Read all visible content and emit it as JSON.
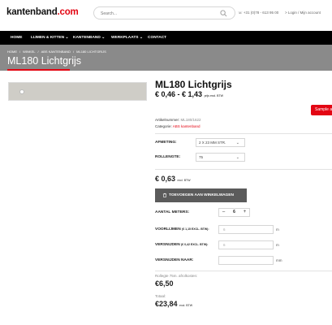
{
  "header": {
    "logo_part1": "kantenband",
    "logo_part2": ".com",
    "search_placeholder": "Search...",
    "phone": "+31 (0)78 - 613 95 00",
    "login": "> Login / Mijn account"
  },
  "nav": {
    "items": [
      {
        "label": "HOME"
      },
      {
        "label": "LIJMEN & KITTEN ⌄"
      },
      {
        "label": "KANTENBAND ⌄"
      },
      {
        "label": "WERKPLAATS ⌄"
      },
      {
        "label": "CONTACT"
      }
    ]
  },
  "breadcrumb": [
    "HOME",
    "/",
    "WINKEL",
    "/",
    "ABS KANTENBAND",
    "/",
    "ML180 LICHTGRIJS"
  ],
  "page_title": "ML180 Lichtgrijs",
  "product": {
    "title": "ML180 Lichtgrijs",
    "price_range": "€ 0,46 - € 1,43",
    "price_range_suffix": "prijs excl. BTW",
    "sample_button": "Sample a",
    "sku_label": "Artikelnummer:",
    "sku_value": "ML180/1622",
    "category_label": "Categorie:",
    "category_value": "ABS kantenband"
  },
  "options": {
    "afmeting_label": "AFMETING:",
    "afmeting_value": "2 X 23 MM STR.",
    "rollengte_label": "ROLLENGTE:",
    "rollengte_value": "75"
  },
  "purchase": {
    "unit_price": "€ 0,63",
    "unit_price_suffix": "excl. BTW",
    "add_to_cart": "TOEVOEGEN AAN WINKELWAGEN",
    "quantity_label": "AANTAL METERS:",
    "quantity_minus": "–",
    "quantity_value": "6",
    "quantity_plus": "+",
    "voorlijmen_label": "VOORLIJMEN",
    "voorlijmen_note": "(€ 1,15 EXCL. BTW):",
    "voorlijmen_value": "6",
    "versnijden_label": "VERSNIJDEN",
    "versnijden_note": "(€ 0,42 EXCL. BTW):",
    "versnijden_value": "6",
    "versnijden_naar_label": "VERSNIJDEN NAAR:",
    "unit_m": "m",
    "unit_mm": "mm"
  },
  "summary": {
    "collection_label": "Rollegte 75m. afrolkosten:",
    "collection_price": "€6,50",
    "total_label": "Totaal:",
    "total_price": "€23,84",
    "total_suffix": "excl. BTW"
  },
  "colors": {
    "brand_red": "#e30613",
    "nav_bg": "#000000",
    "hero_bg": "#8a8a8a",
    "button_bg": "#5b5b5b"
  },
  "icons": [
    "search-icon",
    "phone-icon",
    "cart-icon",
    "chevron-down-icon"
  ]
}
